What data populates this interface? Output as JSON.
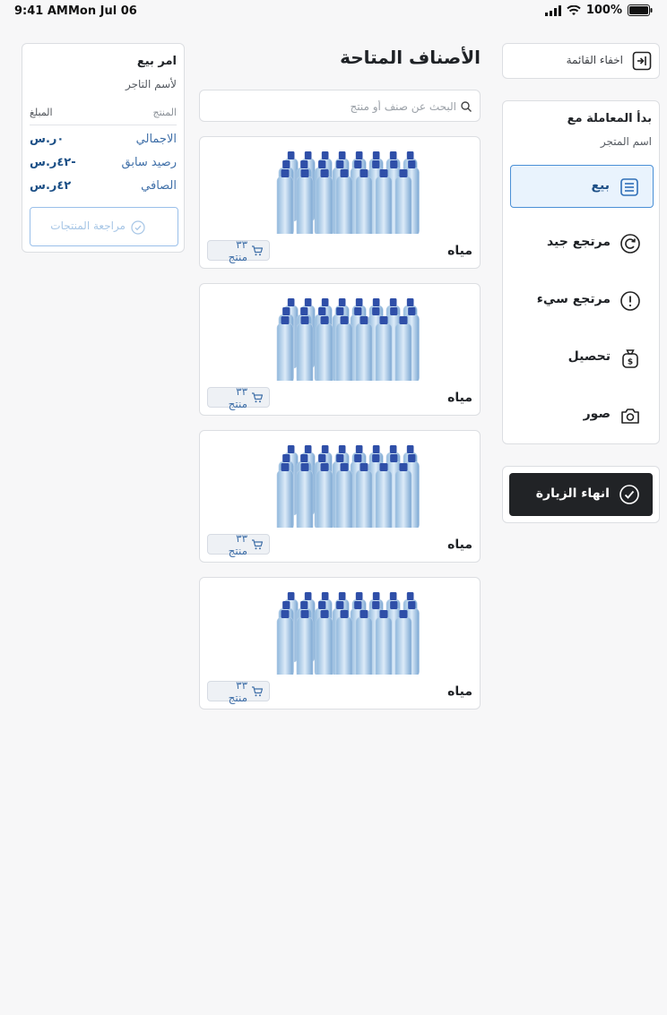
{
  "statusbar": {
    "time": "9:41 AM",
    "date": "Mon Jul 06",
    "battery": "100%"
  },
  "sidebar": {
    "hide_list_label": "اخفاء القائمة",
    "dealing_with": "بدأ المعاملة مع",
    "store_name": "اسم المتجر",
    "items": [
      {
        "label": "بيع",
        "icon": "receipt-icon",
        "active": true
      },
      {
        "label": "مرتجع جيد",
        "icon": "refresh-icon",
        "active": false
      },
      {
        "label": "مرتجع سيء",
        "icon": "alert-icon",
        "active": false
      },
      {
        "label": "تحصيل",
        "icon": "money-bag-icon",
        "active": false
      },
      {
        "label": "صور",
        "icon": "camera-icon",
        "active": false
      }
    ],
    "end_visit_label": "انهاء الزيارة"
  },
  "main": {
    "title": "الأصناف المتاحة",
    "search_placeholder": "البحث عن صنف أو منتج",
    "products": [
      {
        "name": "مياه",
        "badge": "٣٣ منتج"
      },
      {
        "name": "مياه",
        "badge": "٣٣ منتج"
      },
      {
        "name": "مياه",
        "badge": "٣٣ منتج"
      },
      {
        "name": "مياه",
        "badge": "٣٣ منتج"
      }
    ]
  },
  "summary": {
    "title": "امر بيع",
    "merchant": "لأسم التاجر",
    "col_product": "المنتج",
    "col_amount": "المبلغ",
    "rows": [
      {
        "label": "الاجمالي",
        "value": "٠ر.س"
      },
      {
        "label": "رصيد سابق",
        "value": "-٤٢ر.س"
      },
      {
        "label": "الصافي",
        "value": "٤٢ر.س"
      }
    ],
    "review_label": "مراجعة المنتجات"
  },
  "colors": {
    "accent": "#4a8fd6",
    "dark_button": "#212326",
    "value_text": "#1b4f86"
  }
}
